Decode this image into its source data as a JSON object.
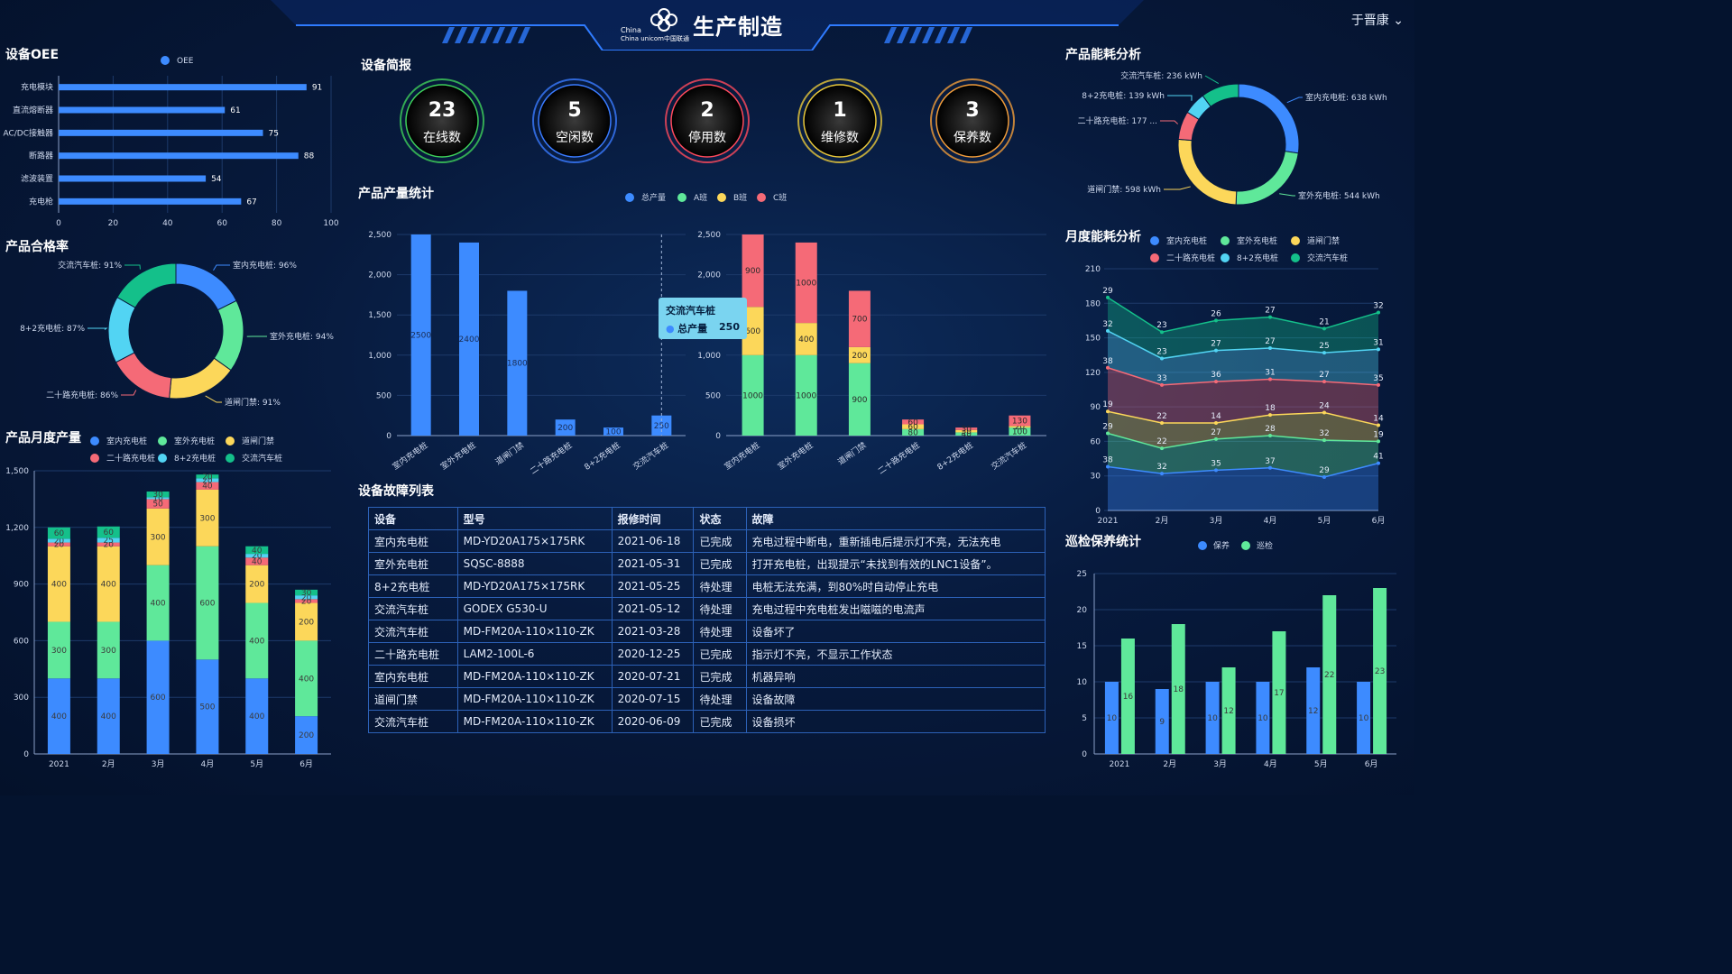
{
  "header": {
    "title": "生产制造",
    "logo_text": "China unicom中国联通",
    "user": "于晋康"
  },
  "oee": {
    "title": "设备OEE",
    "legend": "OEE",
    "chart_data": {
      "type": "bar",
      "categories": [
        "充电模块",
        "直流熔断器",
        "AC/DC接触器",
        "断路器",
        "滤波装置",
        "充电枪"
      ],
      "series": [
        {
          "name": "OEE",
          "values": [
            91,
            61,
            75,
            88,
            54,
            67
          ]
        }
      ],
      "xlim": [
        0,
        100
      ],
      "xticks": [
        0,
        20,
        40,
        60,
        80,
        100
      ]
    }
  },
  "quality": {
    "title": "产品合格率",
    "chart_data": {
      "type": "pie",
      "labels": [
        "室内充电桩: 96%",
        "室外充电桩: 94%",
        "道闸门禁: 91%",
        "二十路充电桩: 86%",
        "8+2充电桩: 87%",
        "交流汽车桩: 91%"
      ],
      "values": [
        96,
        94,
        91,
        86,
        87,
        91
      ]
    }
  },
  "monthly_output": {
    "title": "产品月度产量",
    "legend": [
      "室内充电桩",
      "室外充电桩",
      "道闸门禁",
      "二十路充电桩",
      "8+2充电桩",
      "交流汽车桩"
    ],
    "chart_data": {
      "type": "bar",
      "categories": [
        "2021",
        "2月",
        "3月",
        "4月",
        "5月",
        "6月"
      ],
      "series": [
        {
          "name": "室内充电桩",
          "values": [
            400,
            400,
            600,
            500,
            400,
            200
          ]
        },
        {
          "name": "室外充电桩",
          "values": [
            300,
            300,
            400,
            600,
            400,
            400
          ]
        },
        {
          "name": "道闸门禁",
          "values": [
            400,
            400,
            300,
            300,
            200,
            200
          ]
        },
        {
          "name": "二十路充电桩",
          "values": [
            20,
            20,
            50,
            40,
            40,
            20
          ]
        },
        {
          "name": "8+2充电桩",
          "values": [
            20,
            25,
            10,
            20,
            20,
            20
          ]
        },
        {
          "name": "交流汽车桩",
          "values": [
            60,
            60,
            30,
            20,
            40,
            30
          ]
        }
      ],
      "ylim": [
        0,
        1500
      ],
      "yticks": [
        0,
        300,
        600,
        900,
        1200,
        1500
      ]
    }
  },
  "device_brief": {
    "title": "设备简报",
    "items": [
      {
        "value": "23",
        "label": "在线数",
        "color": "#3ecf5a"
      },
      {
        "value": "5",
        "label": "空闲数",
        "color": "#3a7bff"
      },
      {
        "value": "2",
        "label": "停用数",
        "color": "#ff4a5c"
      },
      {
        "value": "1",
        "label": "维修数",
        "color": "#e9c83b"
      },
      {
        "value": "3",
        "label": "保养数",
        "color": "#f09c3a"
      }
    ]
  },
  "product_output": {
    "title": "产品产量统计",
    "legend": [
      "总产量",
      "A班",
      "B班",
      "C班"
    ],
    "tooltip": {
      "title": "交流汽车桩",
      "label": "总产量",
      "value": "250"
    },
    "chart_data": [
      {
        "type": "bar",
        "categories": [
          "室内充电桩",
          "室外充电桩",
          "道闸门禁",
          "二十路充电桩",
          "8+2充电桩",
          "交流汽车桩"
        ],
        "series": [
          {
            "name": "总产量",
            "values": [
              2500,
              2400,
              1800,
              200,
              100,
              250
            ]
          }
        ],
        "ylim": [
          0,
          2500
        ],
        "yticks": [
          0,
          500,
          1000,
          1500,
          2000,
          2500
        ]
      },
      {
        "type": "bar",
        "categories": [
          "室内充电桩",
          "室外充电桩",
          "道闸门禁",
          "二十路充电桩",
          "8+2充电桩",
          "交流汽车桩"
        ],
        "series": [
          {
            "name": "A班",
            "values": [
              1000,
              1000,
              900,
              80,
              40,
              100
            ]
          },
          {
            "name": "B班",
            "values": [
              600,
              400,
              200,
              60,
              30,
              20
            ]
          },
          {
            "name": "C班",
            "values": [
              900,
              1000,
              700,
              60,
              30,
              130
            ]
          }
        ],
        "ylim": [
          0,
          2500
        ],
        "yticks": [
          0,
          500,
          1000,
          1500,
          2000,
          2500
        ]
      }
    ]
  },
  "faults": {
    "title": "设备故障列表",
    "columns": [
      "设备",
      "型号",
      "报修时间",
      "状态",
      "故障"
    ],
    "rows": [
      [
        "室内充电桩",
        "MD-YD20A175×175RK",
        "2021-06-18",
        "已完成",
        "充电过程中断电，重新插电后提示灯不亮，无法充电"
      ],
      [
        "室外充电桩",
        "SQSC-8888",
        "2021-05-31",
        "已完成",
        "打开充电桩，出现提示“未找到有效的LNC1设备”。"
      ],
      [
        "8+2充电桩",
        "MD-YD20A175×175RK",
        "2021-05-25",
        "待处理",
        "电桩无法充满，到80%时自动停止充电"
      ],
      [
        "交流汽车桩",
        "GODEX G530-U",
        "2021-05-12",
        "待处理",
        "充电过程中充电桩发出嗞嗞的电流声"
      ],
      [
        "交流汽车桩",
        "MD-FM20A-110×110-ZK",
        "2021-03-28",
        "待处理",
        "设备坏了"
      ],
      [
        "二十路充电桩",
        "LAM2-100L-6",
        "2020-12-25",
        "已完成",
        "指示灯不亮，不显示工作状态"
      ],
      [
        "室内充电桩",
        "MD-FM20A-110×110-ZK",
        "2020-07-21",
        "已完成",
        "机器异响"
      ],
      [
        "道闸门禁",
        "MD-FM20A-110×110-ZK",
        "2020-07-15",
        "待处理",
        "设备故障"
      ],
      [
        "交流汽车桩",
        "MD-FM20A-110×110-ZK",
        "2020-06-09",
        "已完成",
        "设备损坏"
      ]
    ]
  },
  "energy": {
    "title": "产品能耗分析",
    "chart_data": {
      "type": "pie",
      "labels": [
        "室内充电桩: 638 kWh",
        "室外充电桩: 544 kWh",
        "道闸门禁: 598 kWh",
        "二十路充电桩: 177 ...",
        "8+2充电桩: 139 kWh",
        "交流汽车桩: 236 kWh"
      ],
      "values": [
        638,
        544,
        598,
        177,
        139,
        236
      ]
    }
  },
  "monthly_energy": {
    "title": "月度能耗分析",
    "legend": [
      "室内充电桩",
      "室外充电桩",
      "道闸门禁",
      "二十路充电桩",
      "8+2充电桩",
      "交流汽车桩"
    ],
    "chart_data": {
      "type": "area",
      "categories": [
        "2021",
        "2月",
        "3月",
        "4月",
        "5月",
        "6月"
      ],
      "series": [
        {
          "name": "室内充电桩",
          "values": [
            38,
            32,
            35,
            37,
            29,
            41
          ]
        },
        {
          "name": "室外充电桩",
          "values": [
            29,
            22,
            27,
            28,
            32,
            19
          ]
        },
        {
          "name": "道闸门禁",
          "values": [
            19,
            22,
            14,
            18,
            24,
            14
          ]
        },
        {
          "name": "二十路充电桩",
          "values": [
            38,
            33,
            36,
            31,
            27,
            35
          ]
        },
        {
          "name": "8+2充电桩",
          "values": [
            32,
            23,
            27,
            27,
            25,
            31
          ]
        },
        {
          "name": "交流汽车桩",
          "values": [
            29,
            23,
            26,
            27,
            21,
            32
          ]
        }
      ],
      "ylim": [
        0,
        210
      ],
      "yticks": [
        0,
        30,
        60,
        90,
        120,
        150,
        180,
        210
      ]
    }
  },
  "inspection": {
    "title": "巡检保养统计",
    "legend": [
      "保养",
      "巡检"
    ],
    "chart_data": {
      "type": "bar",
      "categories": [
        "2021",
        "2月",
        "3月",
        "4月",
        "5月",
        "6月"
      ],
      "series": [
        {
          "name": "保养",
          "values": [
            10,
            9,
            10,
            10,
            12,
            10
          ]
        },
        {
          "name": "巡检",
          "values": [
            16,
            18,
            12,
            17,
            22,
            23
          ]
        }
      ],
      "ylim": [
        0,
        25
      ],
      "yticks": [
        0,
        5,
        10,
        15,
        20,
        25
      ]
    }
  },
  "colors": {
    "blue": "#3d8bff",
    "green": "#5fe89a",
    "yellow": "#fcd75a",
    "red": "#f56a77",
    "cyan": "#52d4f3",
    "teal": "#14c08a"
  }
}
